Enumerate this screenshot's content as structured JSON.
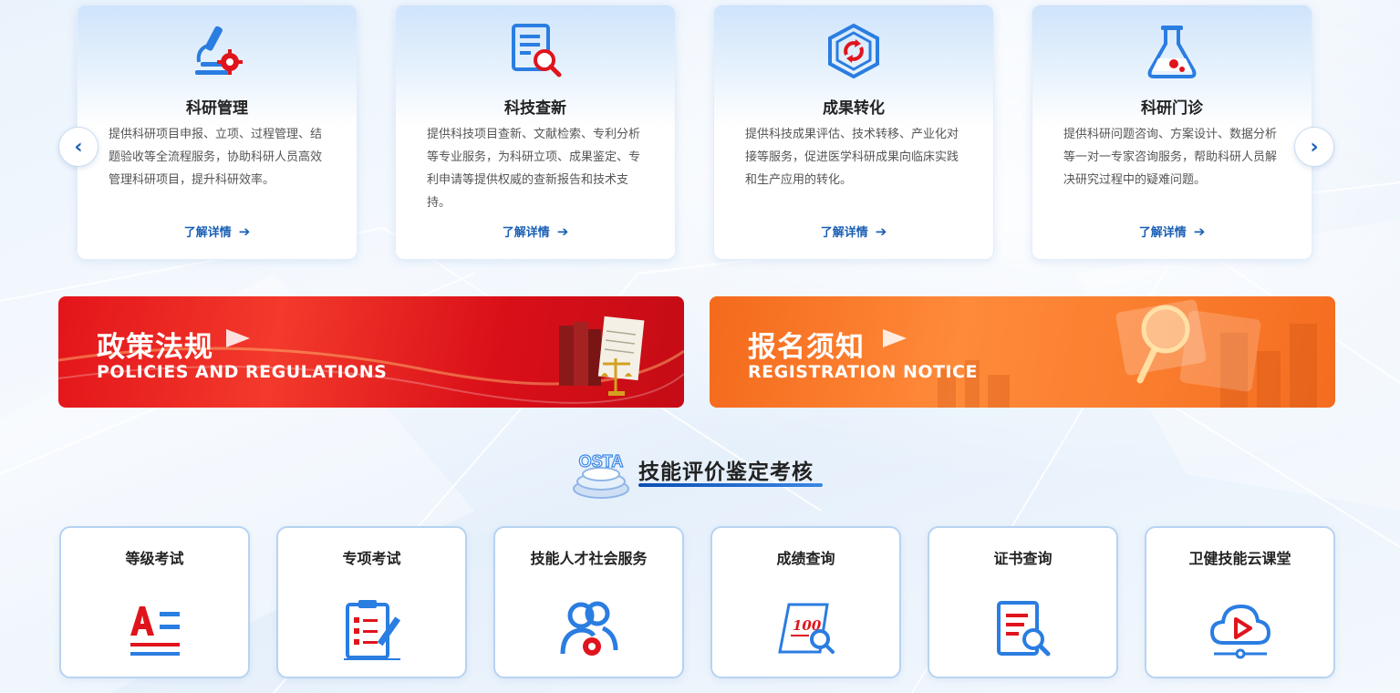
{
  "services": [
    {
      "title": "科研管理",
      "desc": "提供科研项目申报、立项、过程管理、结题验收等全流程服务，协助科研人员高效管理科研项目，提升科研效率。",
      "more": "了解详情",
      "icon": "microscope-gear-icon"
    },
    {
      "title": "科技查新",
      "desc": "提供科技项目查新、文献检索、专利分析等专业服务，为科研立项、成果鉴定、专利申请等提供权威的查新报告和技术支持。",
      "more": "了解详情",
      "icon": "document-search-icon"
    },
    {
      "title": "成果转化",
      "desc": "提供科技成果评估、技术转移、产业化对接等服务，促进医学科研成果向临床实践和生产应用的转化。",
      "more": "了解详情",
      "icon": "cube-transfer-icon"
    },
    {
      "title": "科研门诊",
      "desc": "提供科研问题咨询、方案设计、数据分析等一对一专家咨询服务，帮助科研人员解决研究过程中的疑难问题。",
      "more": "了解详情",
      "icon": "flask-icon"
    }
  ],
  "carousel": {
    "prev": "‹",
    "next": "›"
  },
  "banners": {
    "policy": {
      "zh": "政策法规",
      "en": "POLICIES AND REGULATIONS"
    },
    "notice": {
      "zh": "报名须知",
      "en": "REGISTRATION NOTICE"
    }
  },
  "section": {
    "logo_text": "OSTA",
    "title": "技能评价鉴定考核"
  },
  "tiles": [
    {
      "label": "等级考试",
      "icon": "grade-exam-icon"
    },
    {
      "label": "专项考试",
      "icon": "clipboard-checklist-icon"
    },
    {
      "label": "技能人才社会服务",
      "icon": "users-gear-icon"
    },
    {
      "label": "成绩查询",
      "icon": "score-search-icon"
    },
    {
      "label": "证书查询",
      "icon": "certificate-search-icon"
    },
    {
      "label": "卫健技能云课堂",
      "icon": "cloud-play-icon"
    }
  ],
  "colors": {
    "primary": "#1a5fb4",
    "red_banner": "#e3141a",
    "orange_banner": "#f46a1c",
    "icon_red": "#e0141c",
    "icon_blue": "#2a7de1"
  }
}
